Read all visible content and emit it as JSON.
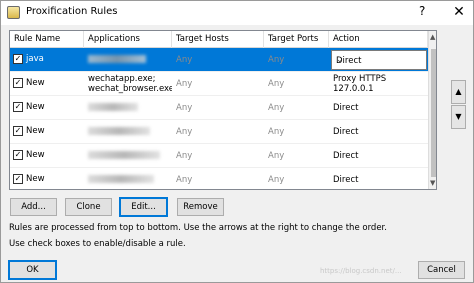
{
  "window": {
    "title": "Proxification Rules",
    "help_symbol": "?",
    "close_symbol": "✕"
  },
  "table": {
    "columns": [
      "Rule Name",
      "Applications",
      "Target Hosts",
      "Target Ports",
      "Action"
    ],
    "rows": [
      {
        "checked": true,
        "name": "java",
        "applications": [],
        "target_hosts": "Any",
        "target_ports": "Any",
        "action": "Direct",
        "selected": true
      },
      {
        "checked": true,
        "name": "New",
        "applications": [
          "wechatapp.exe;",
          "wechat_browser.exe;..."
        ],
        "target_hosts": "Any",
        "target_ports": "Any",
        "action": "Proxy HTTPS 127.0.0.1"
      },
      {
        "checked": true,
        "name": "New",
        "applications": [],
        "target_hosts": "Any",
        "target_ports": "Any",
        "action": "Direct"
      },
      {
        "checked": true,
        "name": "New",
        "applications": [],
        "target_hosts": "Any",
        "target_ports": "Any",
        "action": "Direct"
      },
      {
        "checked": true,
        "name": "New",
        "applications": [],
        "target_hosts": "Any",
        "target_ports": "Any",
        "action": "Direct"
      },
      {
        "checked": true,
        "name": "New",
        "applications": [],
        "target_hosts": "Any",
        "target_ports": "Any",
        "action": "Direct"
      }
    ]
  },
  "buttons": {
    "add": "Add...",
    "clone": "Clone",
    "edit": "Edit...",
    "remove": "Remove",
    "ok": "OK",
    "cancel": "Cancel",
    "up": "▲",
    "down": "▼"
  },
  "info": {
    "line1": "Rules are processed from top to bottom. Use the arrows at the right to change the order.",
    "line2": "Use check boxes to enable/disable a rule."
  },
  "watermark": "https://blog.csdn.net/..."
}
